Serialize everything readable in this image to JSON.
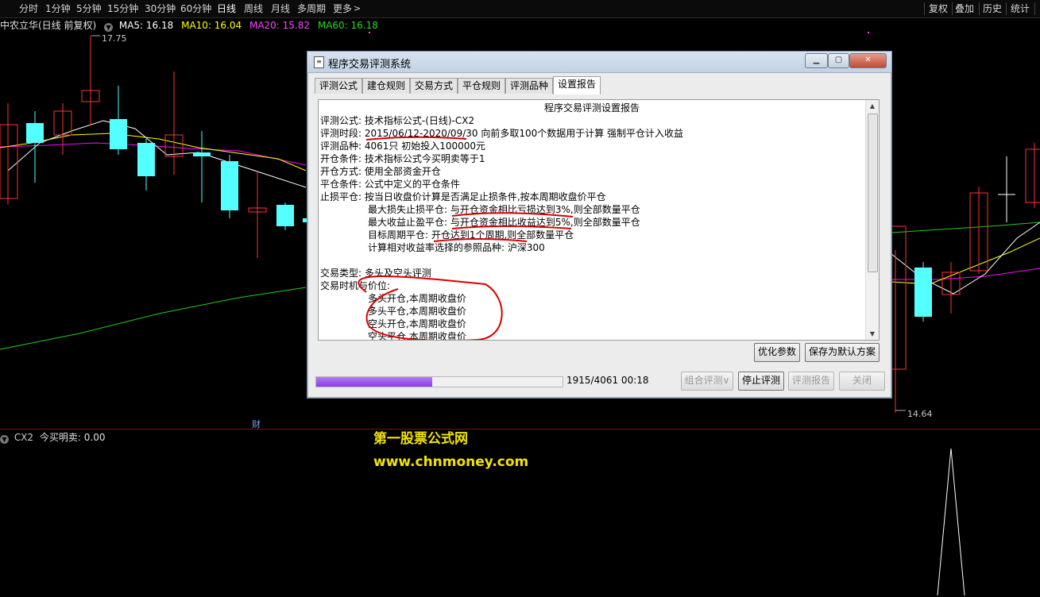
{
  "toolbar": {
    "periods": [
      "分时",
      "1分钟",
      "5分钟",
      "15分钟",
      "30分钟",
      "60分钟",
      "日线",
      "周线",
      "月线",
      "多周期",
      "更多"
    ],
    "active_period": "日线",
    "right_buttons": [
      "复权",
      "叠加",
      "历史",
      "统计"
    ]
  },
  "chart_legend": {
    "title": "中农立华(日线 前复权)",
    "ma5": "MA5: 16.18",
    "ma10": "MA10: 16.04",
    "ma20": "MA20: 15.82",
    "ma60": "MA60: 16.18",
    "colors": {
      "ma5": "#ffffff",
      "ma10": "#ffff00",
      "ma20": "#ff00ff",
      "ma60": "#00ff00",
      "up": "#ff3232",
      "down": "#54ffff"
    }
  },
  "price_labels": {
    "high": "17.75",
    "low": "14.64"
  },
  "finance_marker": "财",
  "indicator": {
    "name": "CX2",
    "value": "今买明卖: 0.00"
  },
  "watermark": {
    "line1": "第一股票公式网",
    "line2": "www.chnmoney.com"
  },
  "dialog": {
    "title": "程序交易评测系统",
    "tabs": [
      "评测公式",
      "建仓规则",
      "交易方式",
      "平仓规则",
      "评测品种",
      "设置报告"
    ],
    "active_tab": "设置报告",
    "report": {
      "heading": "程序交易评测设置报告",
      "formula": "评测公式: 技术指标公式-(日线)-CX2",
      "period": "评测时段: 2015/06/12-2020/09/30 向前多取100个数据用于计算 强制平仓计入收益",
      "varieties": "评测品种: 4061只 初始投入100000元",
      "open_condition": "开仓条件: 技术指标公式今买明卖等于1",
      "open_method": "开仓方式: 使用全部资金开仓",
      "close_condition": "平仓条件: 公式中定义的平仓条件",
      "stop_loss": "止损平仓: 按当日收盘价计算是否满足止损条件,按本周期收盘价平仓",
      "max_loss": "最大损失止损平仓: 与开仓资金相比亏损达到3%,则全部数量平仓",
      "max_profit": "最大收益止盈平仓: 与开仓资金相比收益达到5%,则全部数量平仓",
      "target_period": "目标周期平仓: 开仓达到1个周期,则全部数量平仓",
      "benchmark": "计算相对收益率选择的参照品种: 沪深300",
      "trade_type": "交易类型: 多头及空头评测",
      "timing": "交易时机与价位:",
      "timing_items": [
        "多头开仓,本周期收盘价",
        "多头平仓,本周期收盘价",
        "空头开仓,本周期收盘价",
        "空头平仓,本周期收盘价"
      ]
    },
    "buttons": {
      "optimize": "优化参数",
      "save_default": "保存为默认方案",
      "combo": "组合评测∨",
      "stop": "停止评测",
      "report": "评测报告",
      "close": "关闭"
    },
    "progress": {
      "text": "1915/4061  00:18",
      "fraction": 0.4716
    }
  }
}
